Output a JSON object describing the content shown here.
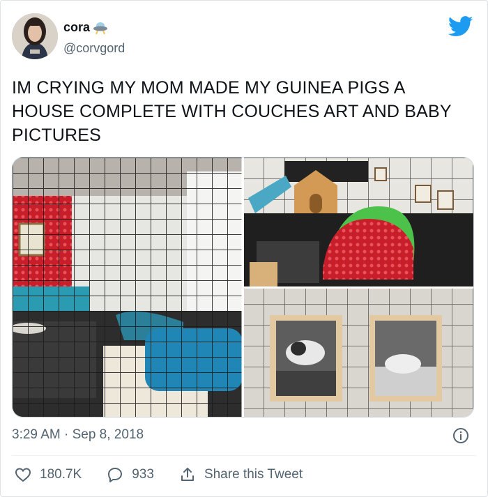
{
  "user": {
    "display_name": "cora",
    "handle": "@corvgord"
  },
  "tweet": {
    "text": "IM CRYING MY MOM MADE MY GUINEA PIGS A HOUSE COMPLETE WITH COUCHES ART AND BABY PICTURES",
    "timestamp": "3:29 AM · Sep 8, 2018"
  },
  "actions": {
    "likes": "180.7K",
    "replies": "933",
    "share_label": "Share this Tweet"
  },
  "colors": {
    "brand": "#1d9bf0",
    "text_secondary": "#536471",
    "border": "#cfd9de"
  },
  "icons": [
    "ufo-emoji-icon",
    "twitter-bird-icon",
    "info-icon",
    "heart-icon",
    "reply-icon",
    "share-icon"
  ]
}
